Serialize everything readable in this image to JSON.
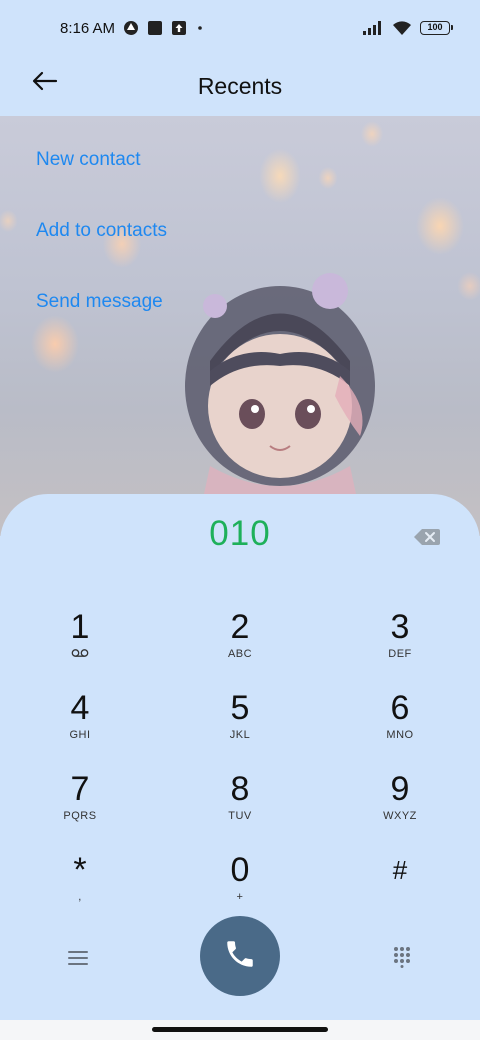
{
  "status_bar": {
    "time": "8:16 AM",
    "battery": "100",
    "icons": [
      "drive-icon",
      "square-app-icon",
      "upload-icon",
      "dot-icon",
      "signal-icon",
      "wifi-icon",
      "battery-icon"
    ]
  },
  "header": {
    "title": "Recents",
    "back_icon": "arrow-left-icon"
  },
  "actions": {
    "new_contact": "New contact",
    "add_to_contacts": "Add to contacts",
    "send_message": "Send message"
  },
  "dialer": {
    "number": "010",
    "number_color": "#1eb05a",
    "accent_link_color": "#1e88f0",
    "call_button_color": "#4a6a88",
    "keys": [
      {
        "digit": "1",
        "letters": ""
      },
      {
        "digit": "2",
        "letters": "ABC"
      },
      {
        "digit": "3",
        "letters": "DEF"
      },
      {
        "digit": "4",
        "letters": "GHI"
      },
      {
        "digit": "5",
        "letters": "JKL"
      },
      {
        "digit": "6",
        "letters": "MNO"
      },
      {
        "digit": "7",
        "letters": "PQRS"
      },
      {
        "digit": "8",
        "letters": "TUV"
      },
      {
        "digit": "9",
        "letters": "WXYZ"
      },
      {
        "digit": "*",
        "letters": ","
      },
      {
        "digit": "0",
        "letters": "+"
      },
      {
        "digit": "#",
        "letters": ""
      }
    ],
    "key1_icon": "voicemail-icon",
    "bottom_icons": [
      "menu-icon",
      "phone-icon",
      "dialpad-icon"
    ]
  }
}
